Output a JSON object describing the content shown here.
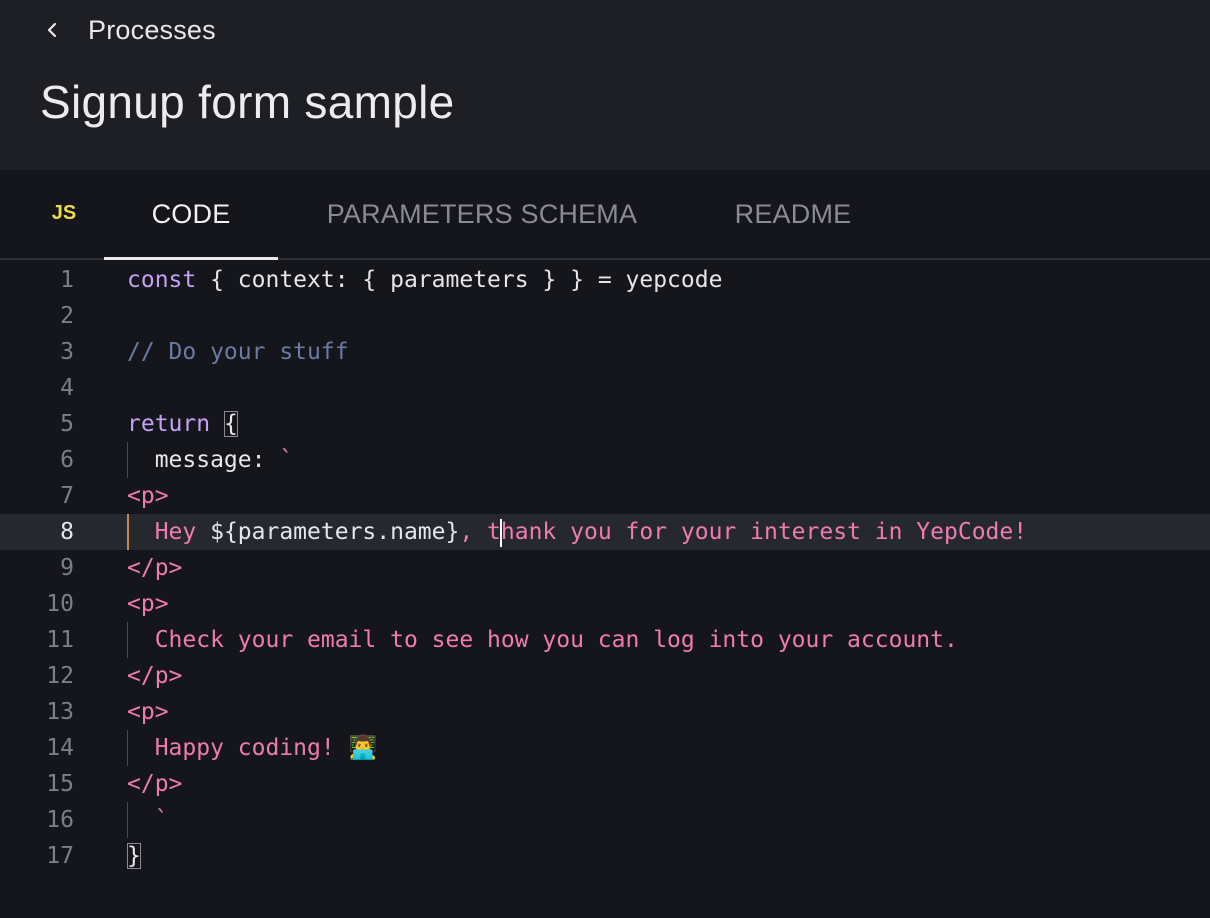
{
  "header": {
    "back_label": "Processes",
    "title": "Signup form sample"
  },
  "tabs": {
    "language_badge": "JS",
    "items": [
      {
        "label": "CODE",
        "active": true
      },
      {
        "label": "PARAMETERS SCHEMA",
        "active": false
      },
      {
        "label": "README",
        "active": false
      }
    ]
  },
  "editor": {
    "language": "javascript",
    "current_line": 8,
    "lines": [
      {
        "n": "1",
        "tokens": [
          [
            "kw",
            "const"
          ],
          [
            "plain",
            " { context: { parameters } } = yepcode"
          ]
        ]
      },
      {
        "n": "2",
        "tokens": []
      },
      {
        "n": "3",
        "tokens": [
          [
            "cm",
            "// Do your stuff"
          ]
        ]
      },
      {
        "n": "4",
        "tokens": []
      },
      {
        "n": "5",
        "tokens": [
          [
            "kw",
            "return"
          ],
          [
            "plain",
            " "
          ],
          [
            "bracket",
            "{"
          ]
        ]
      },
      {
        "n": "6",
        "guide": true,
        "tokens": [
          [
            "plain",
            "  message: "
          ],
          [
            "str",
            "`"
          ]
        ]
      },
      {
        "n": "7",
        "tokens": [
          [
            "str",
            "<p>"
          ]
        ]
      },
      {
        "n": "8",
        "guide": true,
        "tokens": [
          [
            "str",
            "  Hey "
          ],
          [
            "plain",
            "${parameters.name}"
          ],
          [
            "str",
            ", t"
          ],
          [
            "caret",
            ""
          ],
          [
            "str",
            "hank you for your interest in YepCode!"
          ]
        ]
      },
      {
        "n": "9",
        "tokens": [
          [
            "str",
            "</p>"
          ]
        ]
      },
      {
        "n": "10",
        "tokens": [
          [
            "str",
            "<p>"
          ]
        ]
      },
      {
        "n": "11",
        "guide": true,
        "tokens": [
          [
            "str",
            "  Check your email to see how you can log into your account."
          ]
        ]
      },
      {
        "n": "12",
        "tokens": [
          [
            "str",
            "</p>"
          ]
        ]
      },
      {
        "n": "13",
        "tokens": [
          [
            "str",
            "<p>"
          ]
        ]
      },
      {
        "n": "14",
        "guide": true,
        "tokens": [
          [
            "str",
            "  Happy coding! 👨‍💻"
          ]
        ]
      },
      {
        "n": "15",
        "tokens": [
          [
            "str",
            "</p>"
          ]
        ]
      },
      {
        "n": "16",
        "guide": true,
        "tokens": [
          [
            "str",
            "  `"
          ]
        ]
      },
      {
        "n": "17",
        "tokens": [
          [
            "bracket",
            "}"
          ]
        ]
      }
    ]
  },
  "colors": {
    "background": "#15161b",
    "header_bg": "#1e1f24",
    "keyword": "#c6a0f6",
    "comment": "#6c7aa3",
    "string": "#f07bb0",
    "js_badge": "#f0db4f"
  }
}
